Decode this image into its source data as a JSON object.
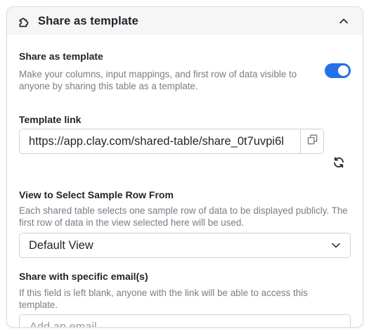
{
  "header": {
    "title": "Share as template",
    "icon": "puzzle-icon",
    "collapse_icon": "chevron-up-icon"
  },
  "share_section": {
    "label": "Share as template",
    "description": "Make your columns, input mappings, and first row of data visible to anyone by sharing this table as a template.",
    "toggle_on": true,
    "accent_color": "#2470e8"
  },
  "template_link": {
    "label": "Template link",
    "value": "https://app.clay.com/shared-table/share_0t7uvpi6l",
    "copy_icon": "copy-icon",
    "refresh_icon": "refresh-icon"
  },
  "sample_row": {
    "label": "View to Select Sample Row From",
    "description": "Each shared table selects one sample row of data to be displayed publicly. The first row of data in the view selected here will be used.",
    "selected": "Default View",
    "dropdown_icon": "chevron-down-icon"
  },
  "email_share": {
    "label": "Share with specific email(s)",
    "description": "If this field is left blank, anyone with the link will be able to access this template.",
    "placeholder": "Add an email",
    "value": ""
  }
}
